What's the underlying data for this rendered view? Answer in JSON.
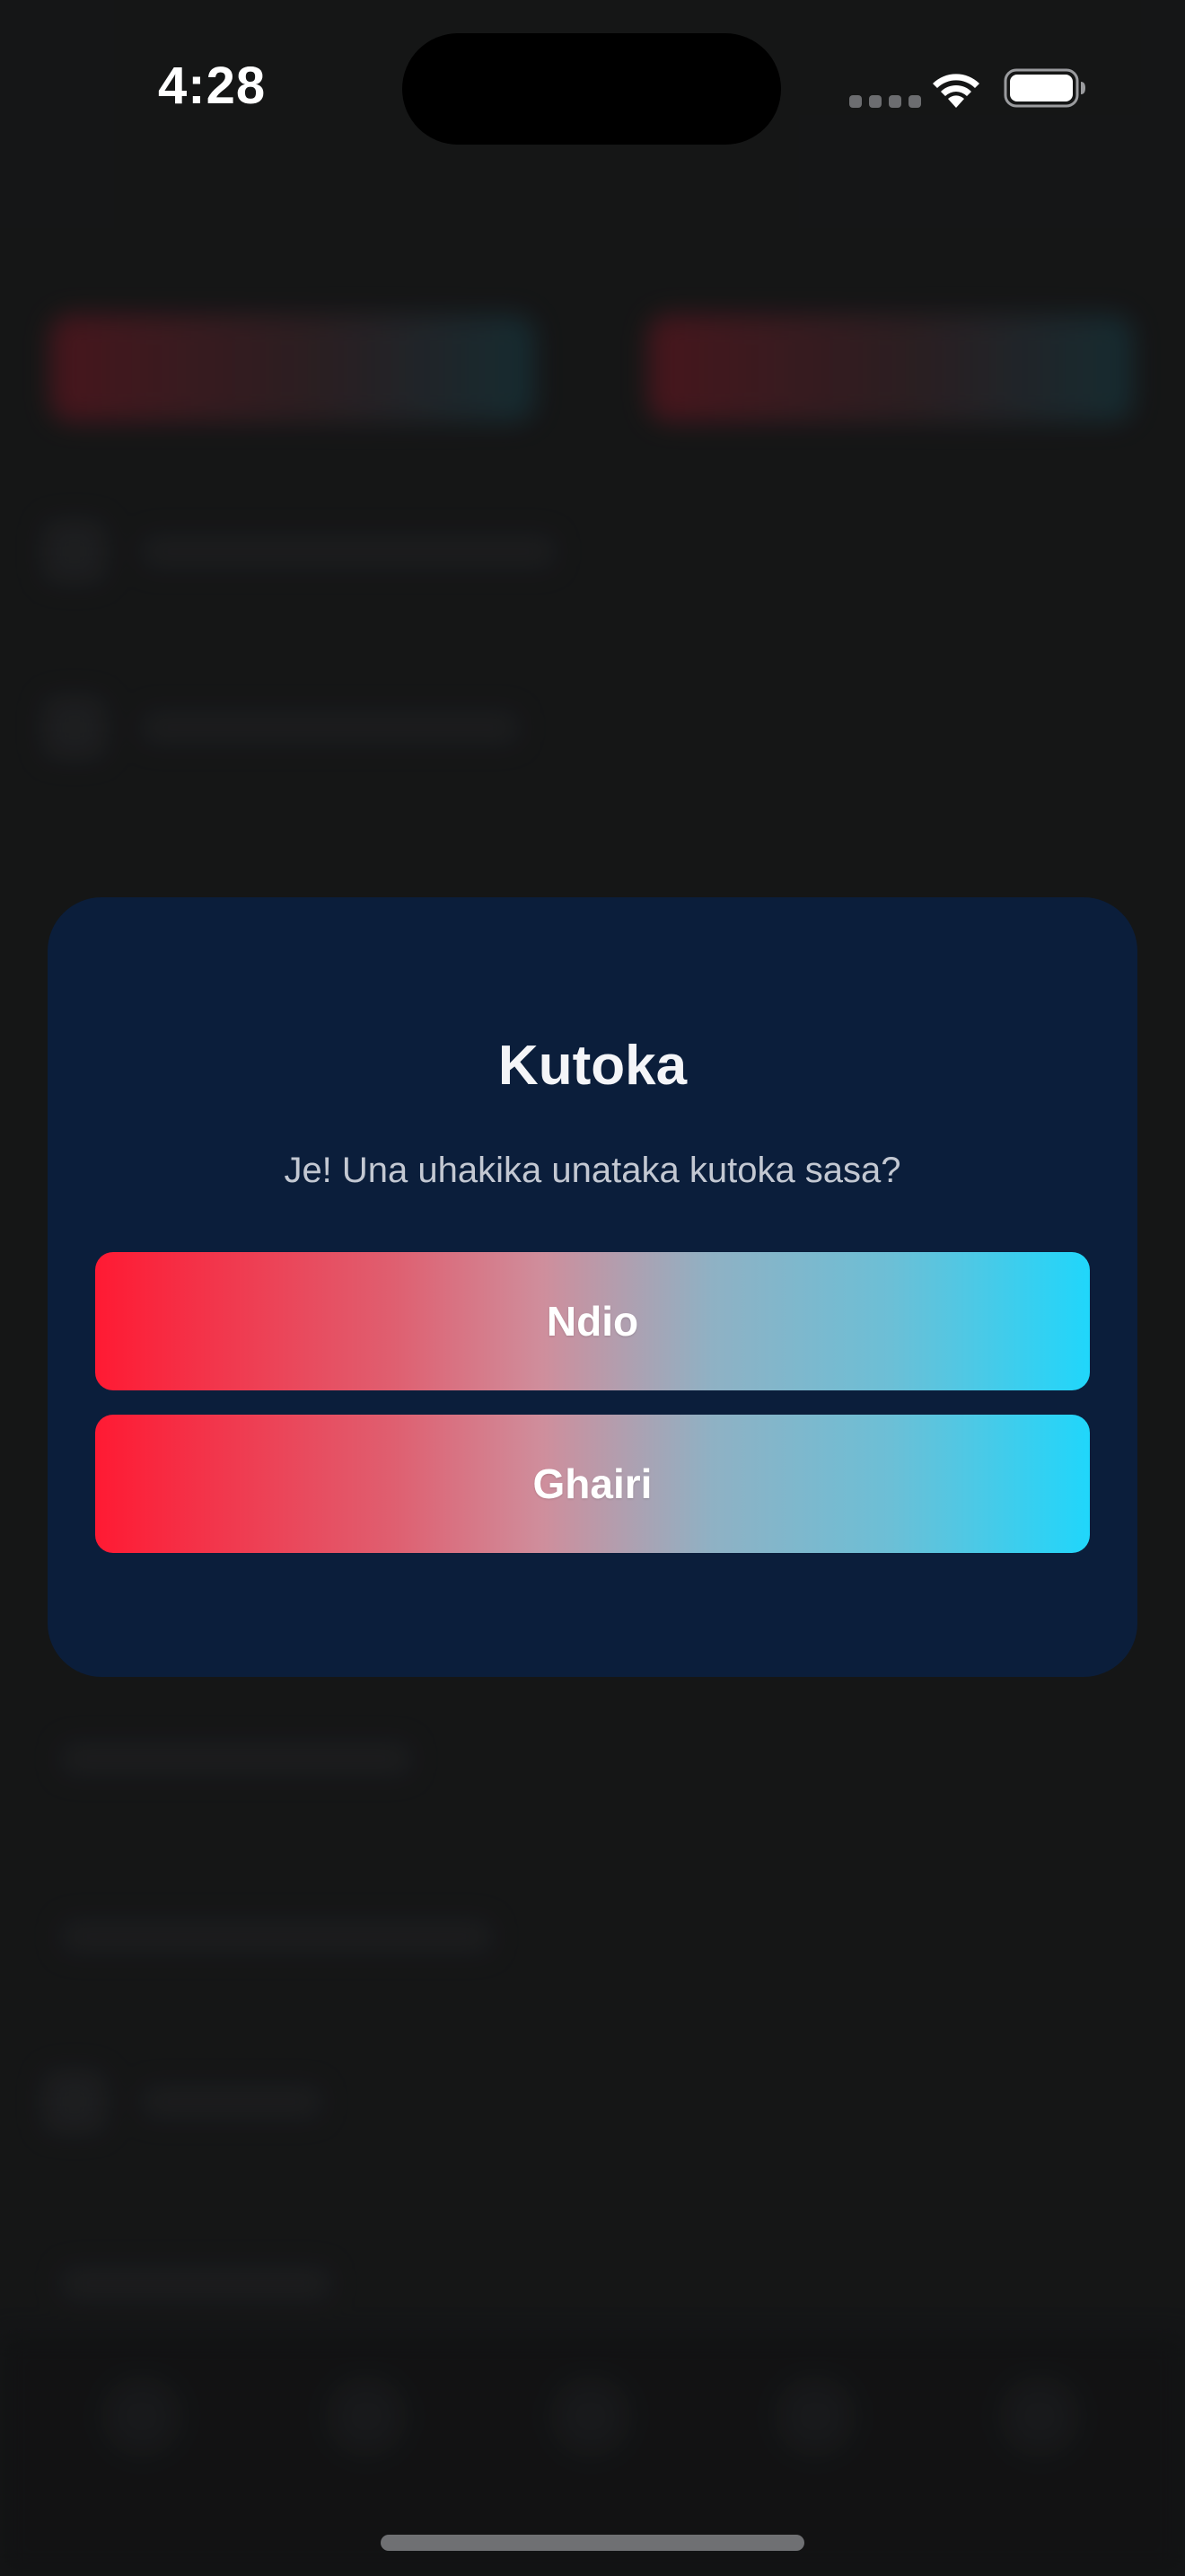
{
  "status_bar": {
    "time": "4:28"
  },
  "dialog": {
    "title": "Kutoka",
    "message": "Je! Una uhakika unataka kutoka sasa?",
    "confirm_label": "Ndio",
    "cancel_label": "Ghairi"
  },
  "icons": {
    "wifi": "wifi-icon",
    "battery": "battery-icon"
  },
  "colors": {
    "dialog_background": "#0b1e3b",
    "button_gradient_start": "#ff1a33",
    "button_gradient_end": "#20d6fb",
    "page_background": "#1a1b1c"
  }
}
